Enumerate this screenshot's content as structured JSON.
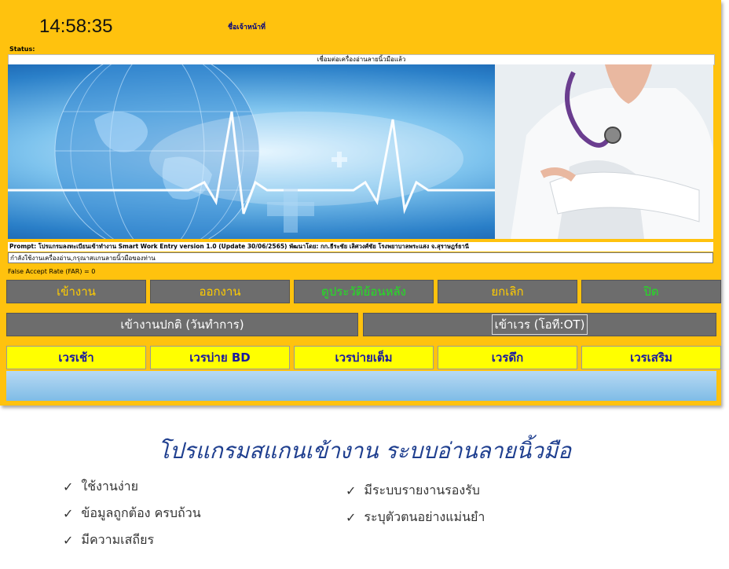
{
  "header": {
    "clock": "14:58:35",
    "officer_label": "ชื่อเจ้าหน้าที่"
  },
  "status": {
    "label": "Status:",
    "connection": "เชื่อมต่อเครื่องอ่านลายนิ้วมือแล้ว"
  },
  "prompt": "Prompt: โปรแกรมลงทะเบียนเข้าทำงาน Smart Work Entry version 1.0 (Update 30/06/2565) พัฒนาโดย: กก.ธีระชัย เลิศวงศ์ชัย โรงพยาบาลพระแสง จ.สุราษฎร์ธานี",
  "instruction": "กำลังใช้งานเครื่องอ่าน,กรุณาสแกนลายนิ้วมือของท่าน",
  "far": "False Accept Rate (FAR) = 0",
  "menu": [
    {
      "label": "เข้างาน",
      "color": "#ffcc00"
    },
    {
      "label": "ออกงาน",
      "color": "#ffcc00"
    },
    {
      "label": "ดูประวัติย้อนหลัง",
      "color": "#22e022"
    },
    {
      "label": "ยกเลิก",
      "color": "#ffcc00"
    },
    {
      "label": "ปิด",
      "color": "#22e022"
    }
  ],
  "modes": {
    "normal": "เข้างานปกติ (วันทำการ)",
    "ot": "เข้าเวร (โอที:OT)"
  },
  "shifts": [
    "เวรเช้า",
    "เวรบ่าย BD",
    "เวรบ่ายเต็ม",
    "เวรดึก",
    "เวรเสริม"
  ],
  "headline": "โปรแกรมสแกนเข้างาน ระบบอ่านลายนิ้วมือ",
  "features": {
    "left": [
      "ใช้งานง่าย",
      "ข้อมูลถูกต้อง ครบถ้วน",
      "มีความเสถียร"
    ],
    "right": [
      "มีระบบรายงานรองรับ",
      "ระบุตัวตนอย่างแม่นยำ"
    ]
  },
  "check_glyph": "✓"
}
